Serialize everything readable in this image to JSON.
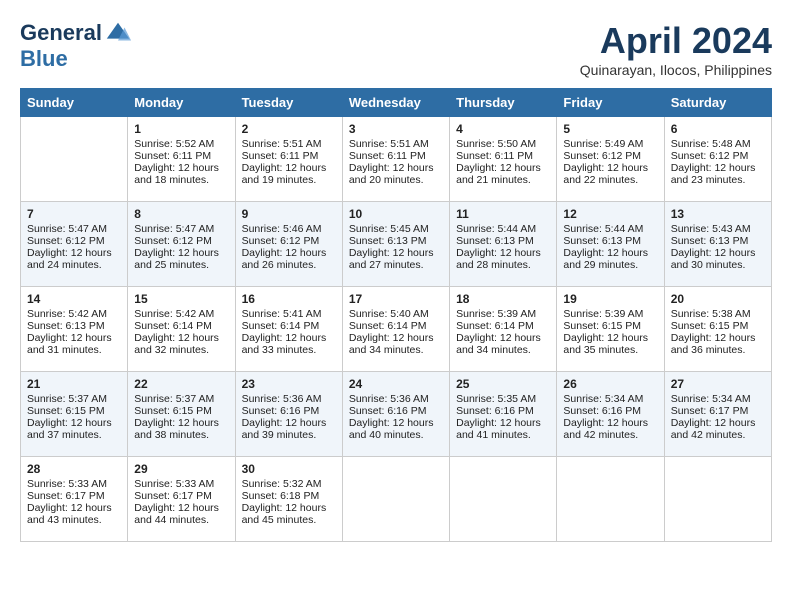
{
  "header": {
    "logo_line1": "General",
    "logo_line2": "Blue",
    "month_title": "April 2024",
    "location": "Quinarayan, Ilocos, Philippines"
  },
  "days_of_week": [
    "Sunday",
    "Monday",
    "Tuesday",
    "Wednesday",
    "Thursday",
    "Friday",
    "Saturday"
  ],
  "weeks": [
    [
      {
        "day": "",
        "content": ""
      },
      {
        "day": "1",
        "content": "Sunrise: 5:52 AM\nSunset: 6:11 PM\nDaylight: 12 hours\nand 18 minutes."
      },
      {
        "day": "2",
        "content": "Sunrise: 5:51 AM\nSunset: 6:11 PM\nDaylight: 12 hours\nand 19 minutes."
      },
      {
        "day": "3",
        "content": "Sunrise: 5:51 AM\nSunset: 6:11 PM\nDaylight: 12 hours\nand 20 minutes."
      },
      {
        "day": "4",
        "content": "Sunrise: 5:50 AM\nSunset: 6:11 PM\nDaylight: 12 hours\nand 21 minutes."
      },
      {
        "day": "5",
        "content": "Sunrise: 5:49 AM\nSunset: 6:12 PM\nDaylight: 12 hours\nand 22 minutes."
      },
      {
        "day": "6",
        "content": "Sunrise: 5:48 AM\nSunset: 6:12 PM\nDaylight: 12 hours\nand 23 minutes."
      }
    ],
    [
      {
        "day": "7",
        "content": "Sunrise: 5:47 AM\nSunset: 6:12 PM\nDaylight: 12 hours\nand 24 minutes."
      },
      {
        "day": "8",
        "content": "Sunrise: 5:47 AM\nSunset: 6:12 PM\nDaylight: 12 hours\nand 25 minutes."
      },
      {
        "day": "9",
        "content": "Sunrise: 5:46 AM\nSunset: 6:12 PM\nDaylight: 12 hours\nand 26 minutes."
      },
      {
        "day": "10",
        "content": "Sunrise: 5:45 AM\nSunset: 6:13 PM\nDaylight: 12 hours\nand 27 minutes."
      },
      {
        "day": "11",
        "content": "Sunrise: 5:44 AM\nSunset: 6:13 PM\nDaylight: 12 hours\nand 28 minutes."
      },
      {
        "day": "12",
        "content": "Sunrise: 5:44 AM\nSunset: 6:13 PM\nDaylight: 12 hours\nand 29 minutes."
      },
      {
        "day": "13",
        "content": "Sunrise: 5:43 AM\nSunset: 6:13 PM\nDaylight: 12 hours\nand 30 minutes."
      }
    ],
    [
      {
        "day": "14",
        "content": "Sunrise: 5:42 AM\nSunset: 6:13 PM\nDaylight: 12 hours\nand 31 minutes."
      },
      {
        "day": "15",
        "content": "Sunrise: 5:42 AM\nSunset: 6:14 PM\nDaylight: 12 hours\nand 32 minutes."
      },
      {
        "day": "16",
        "content": "Sunrise: 5:41 AM\nSunset: 6:14 PM\nDaylight: 12 hours\nand 33 minutes."
      },
      {
        "day": "17",
        "content": "Sunrise: 5:40 AM\nSunset: 6:14 PM\nDaylight: 12 hours\nand 34 minutes."
      },
      {
        "day": "18",
        "content": "Sunrise: 5:39 AM\nSunset: 6:14 PM\nDaylight: 12 hours\nand 34 minutes."
      },
      {
        "day": "19",
        "content": "Sunrise: 5:39 AM\nSunset: 6:15 PM\nDaylight: 12 hours\nand 35 minutes."
      },
      {
        "day": "20",
        "content": "Sunrise: 5:38 AM\nSunset: 6:15 PM\nDaylight: 12 hours\nand 36 minutes."
      }
    ],
    [
      {
        "day": "21",
        "content": "Sunrise: 5:37 AM\nSunset: 6:15 PM\nDaylight: 12 hours\nand 37 minutes."
      },
      {
        "day": "22",
        "content": "Sunrise: 5:37 AM\nSunset: 6:15 PM\nDaylight: 12 hours\nand 38 minutes."
      },
      {
        "day": "23",
        "content": "Sunrise: 5:36 AM\nSunset: 6:16 PM\nDaylight: 12 hours\nand 39 minutes."
      },
      {
        "day": "24",
        "content": "Sunrise: 5:36 AM\nSunset: 6:16 PM\nDaylight: 12 hours\nand 40 minutes."
      },
      {
        "day": "25",
        "content": "Sunrise: 5:35 AM\nSunset: 6:16 PM\nDaylight: 12 hours\nand 41 minutes."
      },
      {
        "day": "26",
        "content": "Sunrise: 5:34 AM\nSunset: 6:16 PM\nDaylight: 12 hours\nand 42 minutes."
      },
      {
        "day": "27",
        "content": "Sunrise: 5:34 AM\nSunset: 6:17 PM\nDaylight: 12 hours\nand 42 minutes."
      }
    ],
    [
      {
        "day": "28",
        "content": "Sunrise: 5:33 AM\nSunset: 6:17 PM\nDaylight: 12 hours\nand 43 minutes."
      },
      {
        "day": "29",
        "content": "Sunrise: 5:33 AM\nSunset: 6:17 PM\nDaylight: 12 hours\nand 44 minutes."
      },
      {
        "day": "30",
        "content": "Sunrise: 5:32 AM\nSunset: 6:18 PM\nDaylight: 12 hours\nand 45 minutes."
      },
      {
        "day": "",
        "content": ""
      },
      {
        "day": "",
        "content": ""
      },
      {
        "day": "",
        "content": ""
      },
      {
        "day": "",
        "content": ""
      }
    ]
  ]
}
